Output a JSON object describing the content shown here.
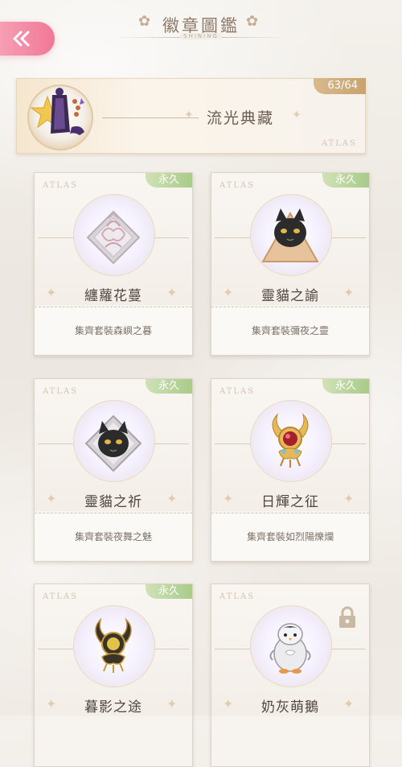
{
  "header": {
    "title": "徽章圖鑑",
    "subtitle": "SHINING"
  },
  "banner": {
    "name": "流光典藏",
    "count": "63/64",
    "atlas": "ATLAS"
  },
  "cards": [
    {
      "name": "纏蘿花蔓",
      "desc": "集齊套裝森嶼之暮",
      "tag": "永久",
      "atlas": "ATLAS"
    },
    {
      "name": "靈貓之諭",
      "desc": "集齊套裝彌夜之靈",
      "tag": "永久",
      "atlas": "ATLAS"
    },
    {
      "name": "靈貓之祈",
      "desc": "集齊套裝夜舞之魅",
      "tag": "永久",
      "atlas": "ATLAS"
    },
    {
      "name": "日輝之征",
      "desc": "集齊套裝如烈陽爍爛",
      "tag": "永久",
      "atlas": "ATLAS"
    },
    {
      "name": "暮影之途",
      "desc": "",
      "tag": "永久",
      "atlas": "ATLAS"
    },
    {
      "name": "奶灰萌鵝",
      "desc": "",
      "tag": "",
      "atlas": "ATLAS",
      "locked": true
    }
  ]
}
